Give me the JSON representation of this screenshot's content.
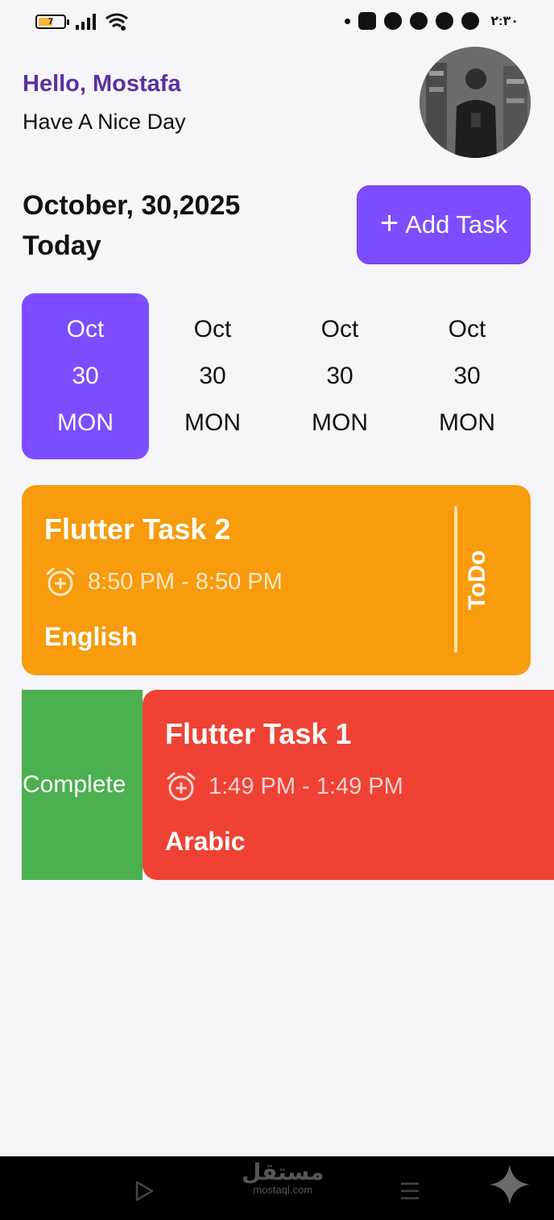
{
  "status_bar": {
    "battery_level": "7",
    "clock": "٢:٣٠",
    "icons": [
      "signal-icon",
      "wifi-icon",
      "notification-dot",
      "app-icon",
      "app-icon",
      "app-icon",
      "whatsapp-icon",
      "chat-icon"
    ]
  },
  "header": {
    "greeting": "Hello, Mostafa",
    "subtitle": "Have A Nice Day"
  },
  "date_section": {
    "date": "October, 30,2025",
    "today": "Today",
    "add_task_plus": "+",
    "add_task_label": "Add Task"
  },
  "date_picker": [
    {
      "month": "Oct",
      "day": "30",
      "weekday": "MON",
      "selected": true
    },
    {
      "month": "Oct",
      "day": "30",
      "weekday": "MON",
      "selected": false
    },
    {
      "month": "Oct",
      "day": "30",
      "weekday": "MON",
      "selected": false
    },
    {
      "month": "Oct",
      "day": "30",
      "weekday": "MON",
      "selected": false
    }
  ],
  "tasks": [
    {
      "title": "Flutter Task 2",
      "time": "8:50 PM - 8:50 PM",
      "category": "English",
      "status": "ToDo",
      "color": "#f89b0c"
    },
    {
      "title": "Flutter Task 1",
      "time": "1:49 PM - 1:49 PM",
      "category": "Arabic",
      "color": "#ef4234",
      "swipe_action": "Complete",
      "swipe_color": "#4caf50"
    }
  ],
  "colors": {
    "accent": "#7c4dff",
    "greeting": "#5b2fa0",
    "background": "#f6f6fa"
  },
  "nav_bar": {
    "watermark_arabic": "مستقل",
    "watermark_latin": "mostaql.com"
  }
}
